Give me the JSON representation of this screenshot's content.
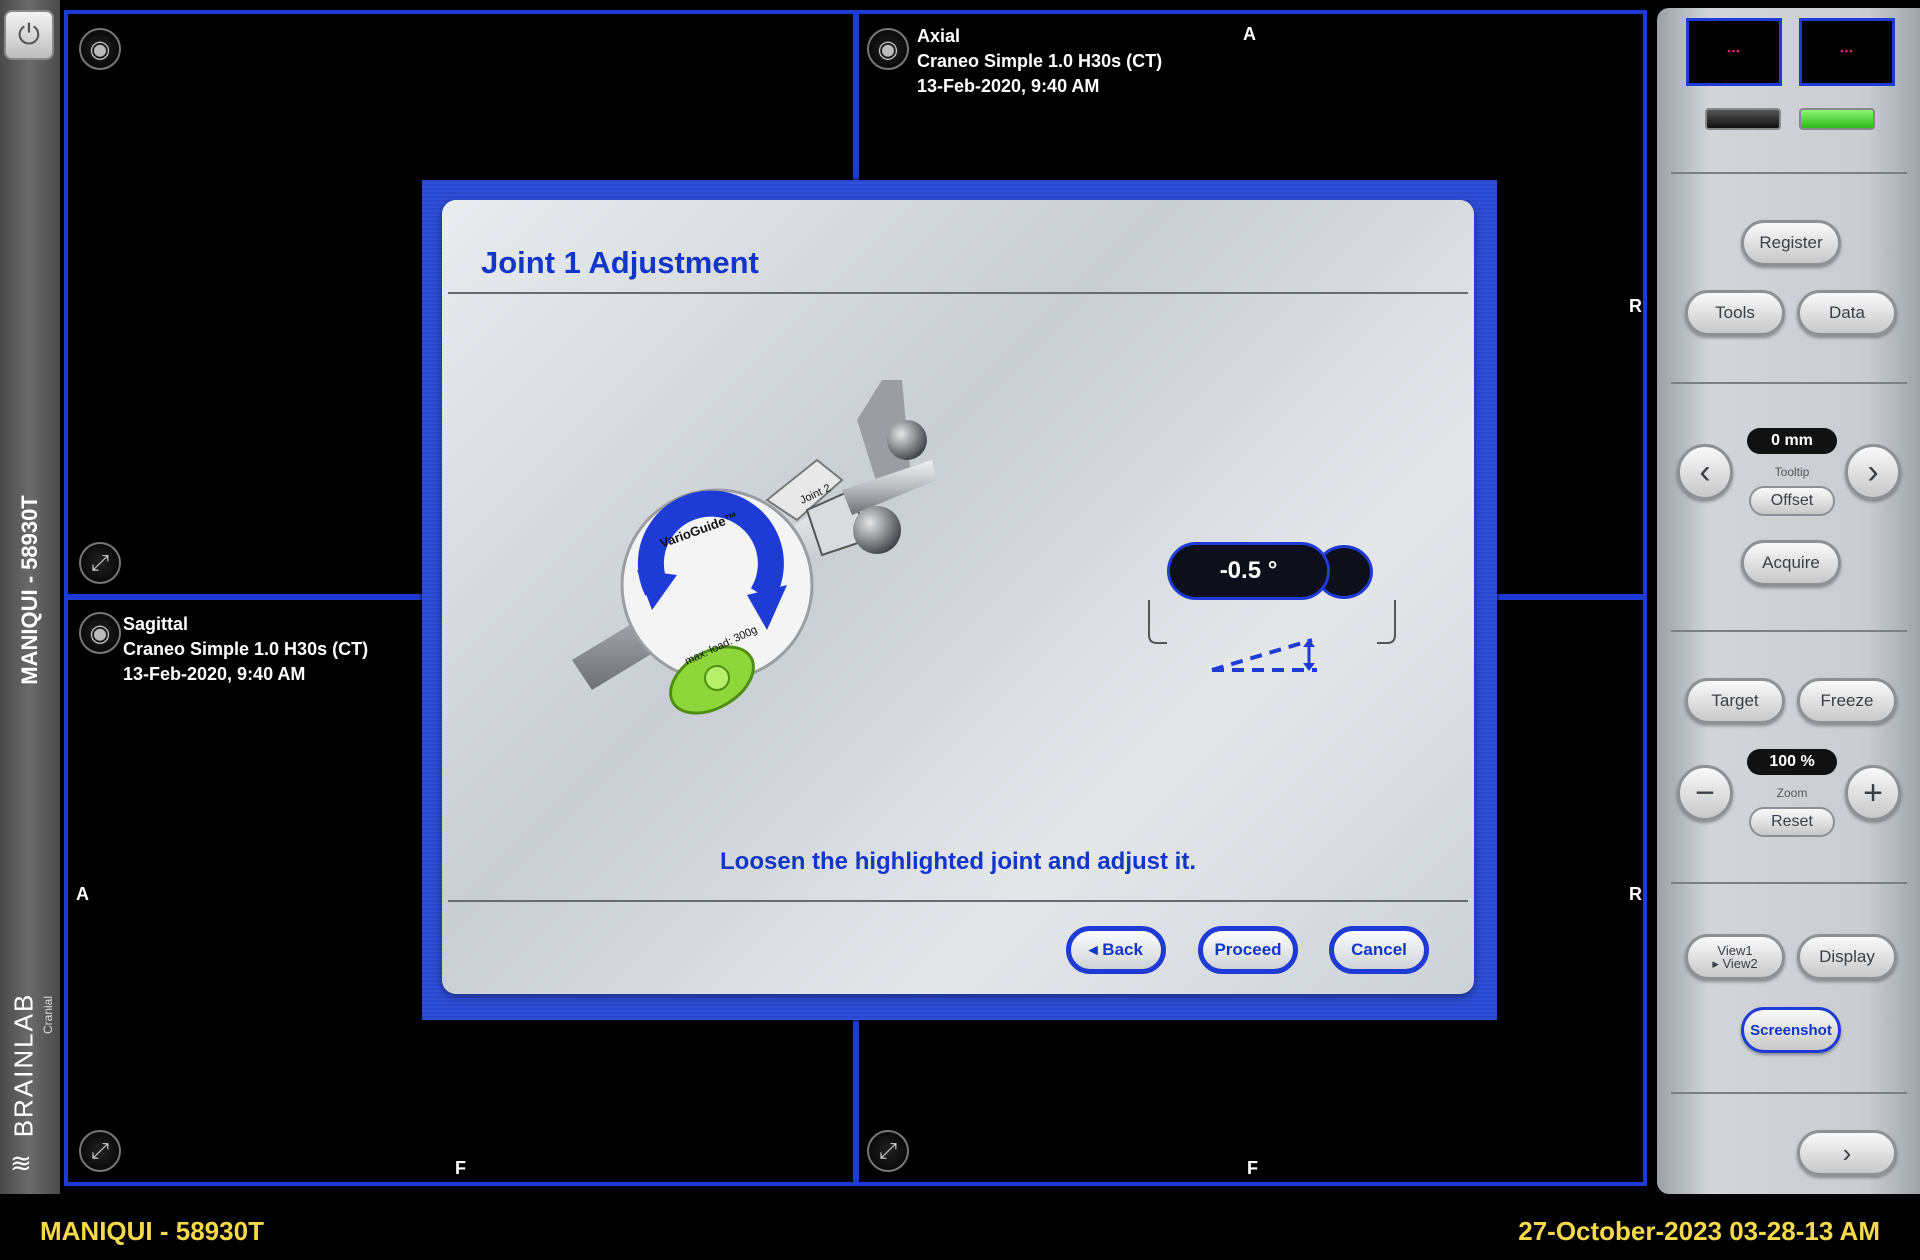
{
  "patient": {
    "vertical_label": "MANIQUI - 58930T"
  },
  "brand": {
    "name": "BRAINLAB",
    "sub": "Cranial"
  },
  "viewports": {
    "axial": {
      "line1": "Axial",
      "line2": "Craneo Simple  1.0  H30s (CT)",
      "line3": "13-Feb-2020, 9:40 AM"
    },
    "sagittal": {
      "line1": "Sagittal",
      "line2": "Craneo Simple  1.0  H30s (CT)",
      "line3": "13-Feb-2020, 9:40 AM"
    },
    "orientation": {
      "axial_top": "A",
      "axial_right": "R",
      "sagittal_left": "A",
      "sagittal_bottom": "F",
      "bottom_right_r": "R",
      "bottom_right_f": "F"
    }
  },
  "dialog": {
    "title": "Joint 1 Adjustment",
    "angle": "-0.5 °",
    "message": "Loosen the highlighted joint and adjust it.",
    "back": "◂ Back",
    "proceed": "Proceed",
    "cancel": "Cancel",
    "device_label": "VarioGuide™",
    "device_load": "max. load: 300g",
    "device_joint": "Joint 2"
  },
  "panel": {
    "register": "Register",
    "tools": "Tools",
    "data": "Data",
    "tooltip_value": "0 mm",
    "tooltip_label": "Tooltip",
    "offset": "Offset",
    "acquire": "Acquire",
    "target": "Target",
    "freeze": "Freeze",
    "zoom_value": "100 %",
    "zoom_label": "Zoom",
    "reset": "Reset",
    "view_toggle_1": "View1",
    "view_toggle_2": "▸ View2",
    "display": "Display",
    "screenshot": "Screenshot",
    "status_colors": {
      "left": "#222222",
      "right": "#3ddc2a"
    }
  },
  "footer": {
    "patient": "MANIQUI - 58930T",
    "datetime": "27-October-2023  03-28-13 AM"
  }
}
